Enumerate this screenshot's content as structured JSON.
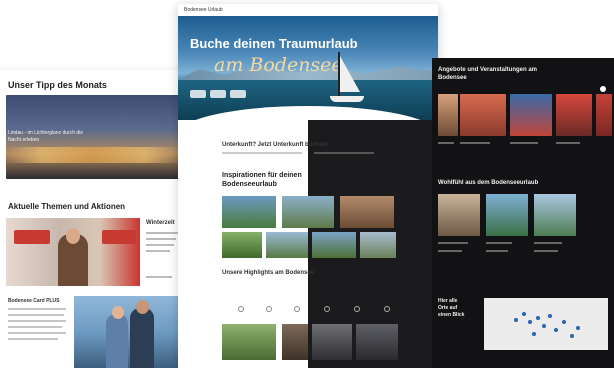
{
  "left_page": {
    "tip_title": "Unser Tipp des Monats",
    "tip_text": "Lindau - im Lichterglanz durch die Nacht erleben",
    "topics_title": "Aktuelle Themen und Aktionen",
    "side_title": "Winterzeit",
    "card_title": "Bodensee Card PLUS"
  },
  "center_page": {
    "logo": "Bodensee Urlaub",
    "hero_title": "Buche deinen Traumurlaub",
    "hero_script": "am Bodensee",
    "question": "Unterkunft? Jetzt Unterkunft buchen!",
    "inspiration_title_line1": "Inspirationen für deinen",
    "inspiration_title_line2": "Bodenseeurlaub",
    "highlights_title": "Unsere Highlights am Bodensee"
  },
  "right_page": {
    "title_line1": "Angebote und Veranstaltungen am",
    "title_line2": "Bodensee",
    "section_title": "Wohlfühl aus dem Bodenseeurlaub",
    "map_title_line1": "Hier alle",
    "map_title_line2": "Orte auf",
    "map_title_line3": "einen Blick"
  },
  "colors": {
    "hero_blue": "#1e5d90",
    "dark_bg": "#121214",
    "accent_gold": "#f6d9a0",
    "map_dot": "#2a64b0"
  }
}
